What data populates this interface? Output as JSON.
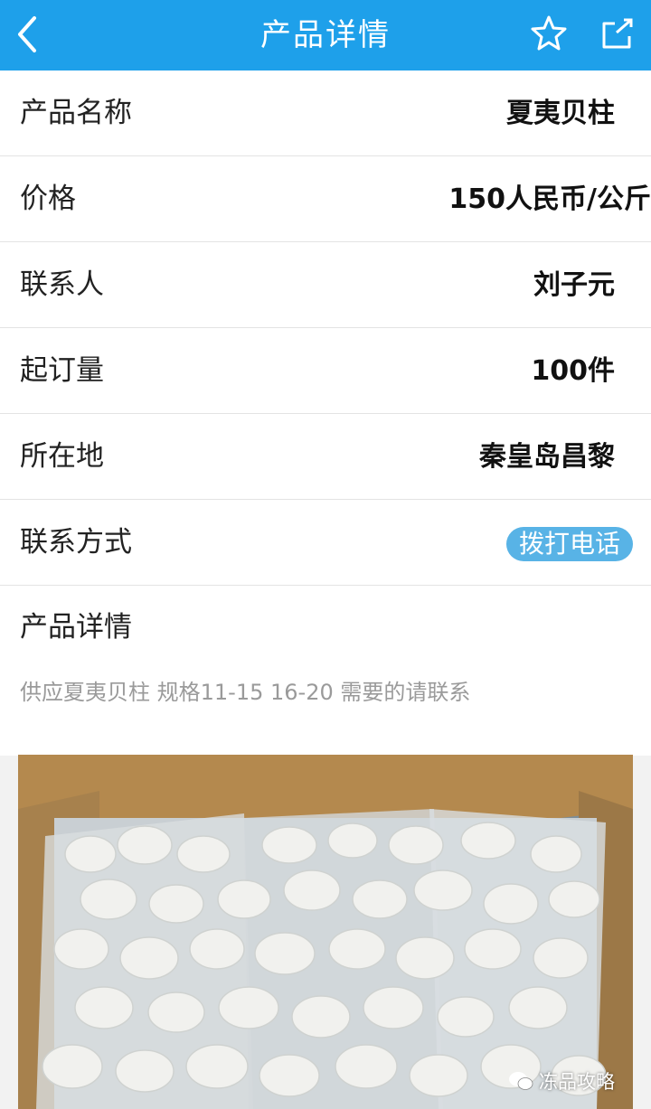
{
  "header": {
    "title": "产品详情",
    "icons": [
      "back-arrow-icon",
      "star-icon",
      "share-icon"
    ]
  },
  "product": {
    "fields": [
      {
        "label": "产品名称",
        "value": "夏夷贝柱"
      },
      {
        "label": "价格",
        "value": "150人民币/公斤"
      },
      {
        "label": "联系人",
        "value": "刘子元"
      },
      {
        "label": "起订量",
        "value": "100件"
      },
      {
        "label": "所在地",
        "value": "秦皇岛昌黎"
      }
    ],
    "contact_label": "联系方式",
    "call_button": "拨打电话",
    "detail_title": "产品详情",
    "detail_text": "供应夏夷贝柱 规格11-15 16-20 需要的请联系"
  },
  "image": {
    "watermark": "冻品攻略"
  },
  "colors": {
    "header_bg": "#1ea0ea",
    "call_button_bg": "#58b3e6"
  }
}
